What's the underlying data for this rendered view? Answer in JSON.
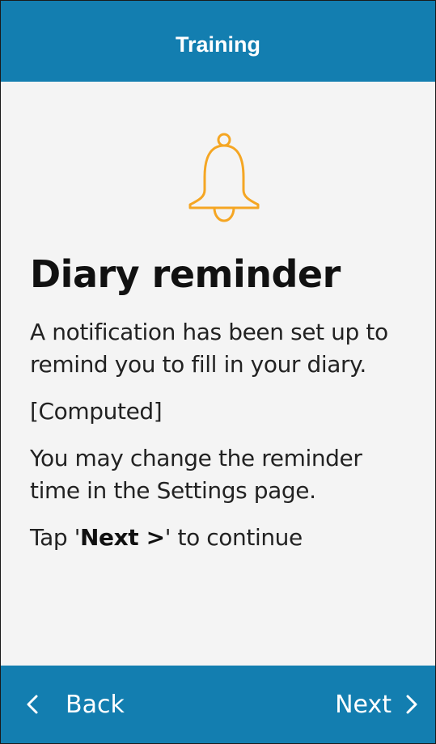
{
  "header": {
    "title": "Training"
  },
  "main": {
    "icon": "bell-icon",
    "icon_color": "#f5a623",
    "title": "Diary reminder",
    "paragraph_1": "A notification has been set up to remind you to fill in your diary.",
    "computed": "[Computed]",
    "paragraph_2": "You may change the reminder time in the Settings page.",
    "instruction_prefix": "Tap '",
    "instruction_emphasis": "Next >",
    "instruction_suffix": "' to continue"
  },
  "footer": {
    "back_label": "Back",
    "back_icon": "chevron-left-icon",
    "next_label": "Next",
    "next_icon": "chevron-right-icon"
  },
  "colors": {
    "bar": "#137eb0",
    "background": "#f4f4f4",
    "text": "#222222"
  }
}
